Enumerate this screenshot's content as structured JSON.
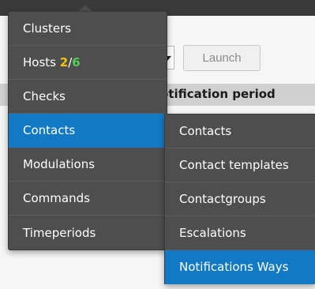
{
  "background": {
    "launch_label": "Launch",
    "table_header": "otification period"
  },
  "menu": {
    "items": [
      {
        "id": "clusters",
        "label": "Clusters"
      },
      {
        "id": "hosts",
        "label": "Hosts",
        "count_ok": "2",
        "separator": "/",
        "count_total": "6"
      },
      {
        "id": "checks",
        "label": "Checks"
      },
      {
        "id": "contacts",
        "label": "Contacts",
        "active": true
      },
      {
        "id": "modulations",
        "label": "Modulations"
      },
      {
        "id": "commands",
        "label": "Commands"
      },
      {
        "id": "timeperiods",
        "label": "Timeperiods"
      }
    ]
  },
  "submenu": {
    "items": [
      {
        "id": "contacts",
        "label": "Contacts"
      },
      {
        "id": "contact-templates",
        "label": "Contact templates"
      },
      {
        "id": "contactgroups",
        "label": "Contactgroups"
      },
      {
        "id": "escalations",
        "label": "Escalations"
      },
      {
        "id": "notifications-ways",
        "label": "Notifications Ways",
        "active": true
      }
    ]
  },
  "colors": {
    "menu_bg": "#4e4e4e",
    "active_bg": "#1279c4",
    "hosts_ok": "#f1c40f",
    "hosts_total": "#52d152"
  }
}
